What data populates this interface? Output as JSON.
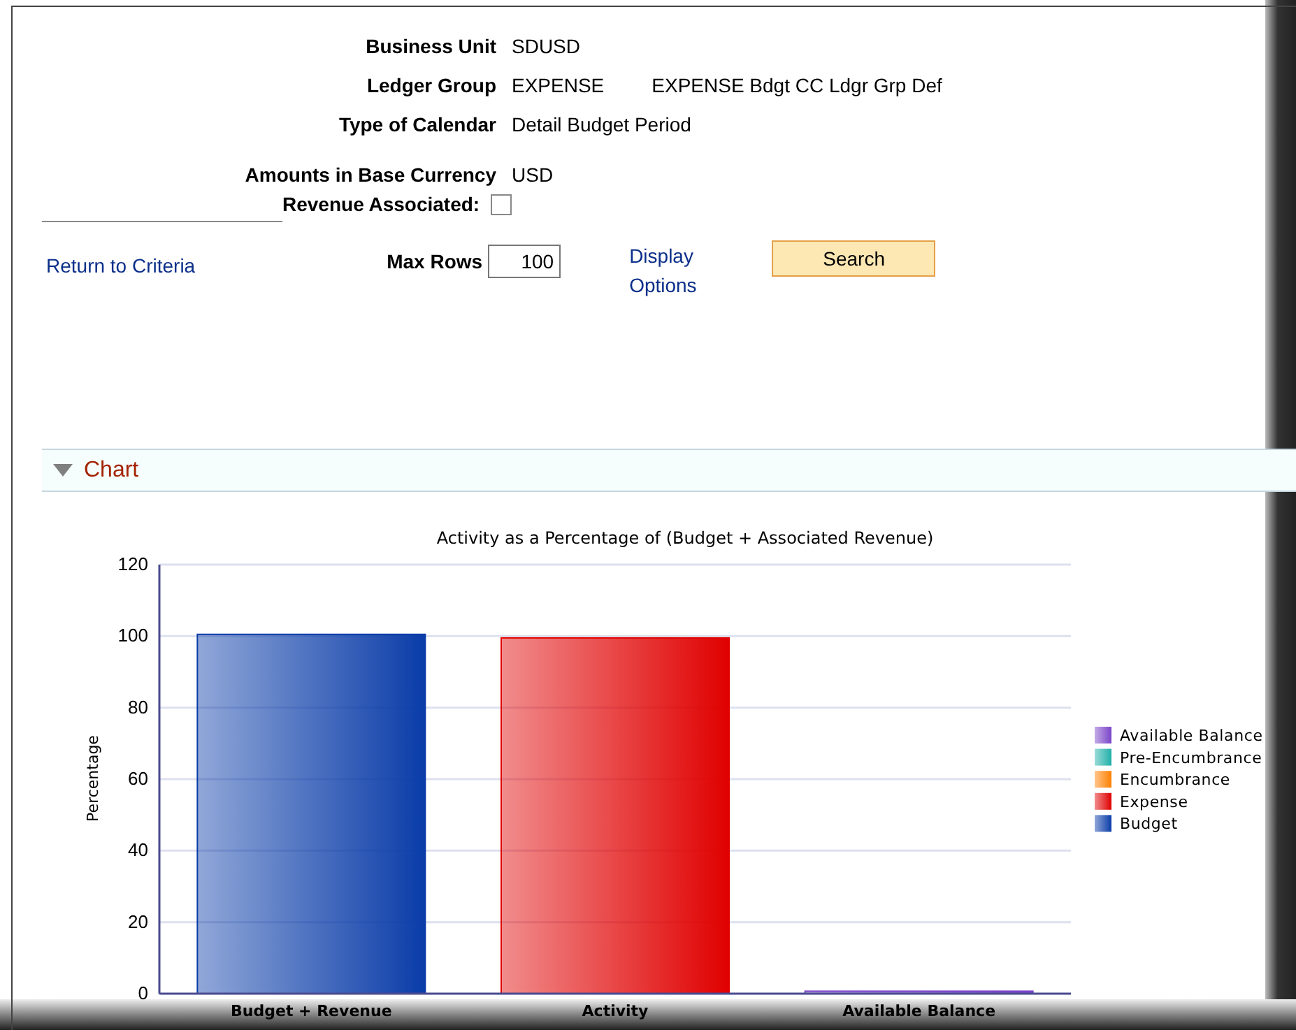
{
  "fields": [
    {
      "label": "Business Unit",
      "values": [
        "SDUSD"
      ]
    },
    {
      "label": "Ledger Group",
      "values": [
        "EXPENSE",
        "EXPENSE Bdgt CC Ldgr Grp Def"
      ]
    },
    {
      "label": "Type of Calendar",
      "values": [
        "Detail Budget Period"
      ]
    },
    {
      "label": "Amounts in Base Currency",
      "values": [
        "USD"
      ]
    }
  ],
  "revenue_associated": {
    "label": "Revenue Associated:",
    "checked": false
  },
  "return_link": "Return to Criteria",
  "max_rows": {
    "label": "Max Rows",
    "value": "100"
  },
  "display_options": [
    "Display",
    "Options"
  ],
  "search_button": "Search",
  "chart_section": {
    "title": "Chart",
    "expanded": true,
    "chart_data": {
      "type": "bar",
      "stacked": true,
      "grid": true,
      "legend": true,
      "title": "Activity as a Percentage of (Budget + Associated Revenue)",
      "ylabel": "Percentage",
      "categories": [
        "Budget + Revenue",
        "Activity",
        "Available Balance"
      ],
      "ylim": [
        0,
        120
      ],
      "yticks": [
        0,
        20,
        40,
        60,
        80,
        100,
        120
      ],
      "series": [
        {
          "name": "Available Balance",
          "color": "#7a44c8",
          "values": [
            0,
            0,
            0.7
          ]
        },
        {
          "name": "Pre-Encumbrance",
          "color": "#20b0a8",
          "values": [
            0,
            0,
            0
          ]
        },
        {
          "name": "Encumbrance",
          "color": "#ff8000",
          "values": [
            0,
            0,
            0
          ]
        },
        {
          "name": "Expense",
          "color": "#e00000",
          "values": [
            0,
            99.5,
            0
          ]
        },
        {
          "name": "Budget",
          "color": "#0a3ca8",
          "values": [
            100.5,
            0,
            0
          ]
        }
      ]
    }
  }
}
